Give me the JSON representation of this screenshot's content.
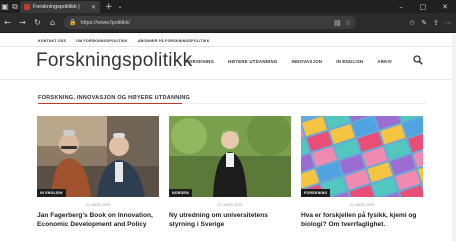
{
  "browser": {
    "tab_title": "Forskningspolitikk |",
    "tab_close": "✕",
    "new_tab": "+",
    "tab_dropdown": "⌄",
    "url": "https://www.fpolitikk/",
    "window_controls": {
      "minimize": "–",
      "maximize": "□",
      "close": "✕"
    }
  },
  "site": {
    "top_links": [
      "KONTAKT OSS",
      "OM FORSKNINGSPOLITIKK",
      "ABONNER PÅ FORSKNINGSPOLITIKK"
    ],
    "logo": "Forskningspolitikk",
    "nav": [
      "FORSKNING",
      "HØYERE UTDANNING",
      "INNOVASJON",
      "IN ENGLISH",
      "ARKIV"
    ],
    "section_title": "FORSKNING, INNOVASJON OG HØYERE UTDANNING",
    "articles": [
      {
        "badge": "IN ENGLISH",
        "date": "20. MARS 2019",
        "title": "Jan Fagerberg's Book on Innovation, Economic Development and Policy"
      },
      {
        "badge": "NORDEN",
        "date": "20. MARS 2019",
        "title": "Ny utredning om universitetens styrning i Sverige"
      },
      {
        "badge": "FORSKNING",
        "date": "20. MARS 2019",
        "title": "Hva er forskjellen på fysikk, kjemi og biologi? Om tverrfaglighet."
      }
    ]
  },
  "colors": {
    "accent": "#c0392b",
    "chrome_dark": "#202020"
  }
}
